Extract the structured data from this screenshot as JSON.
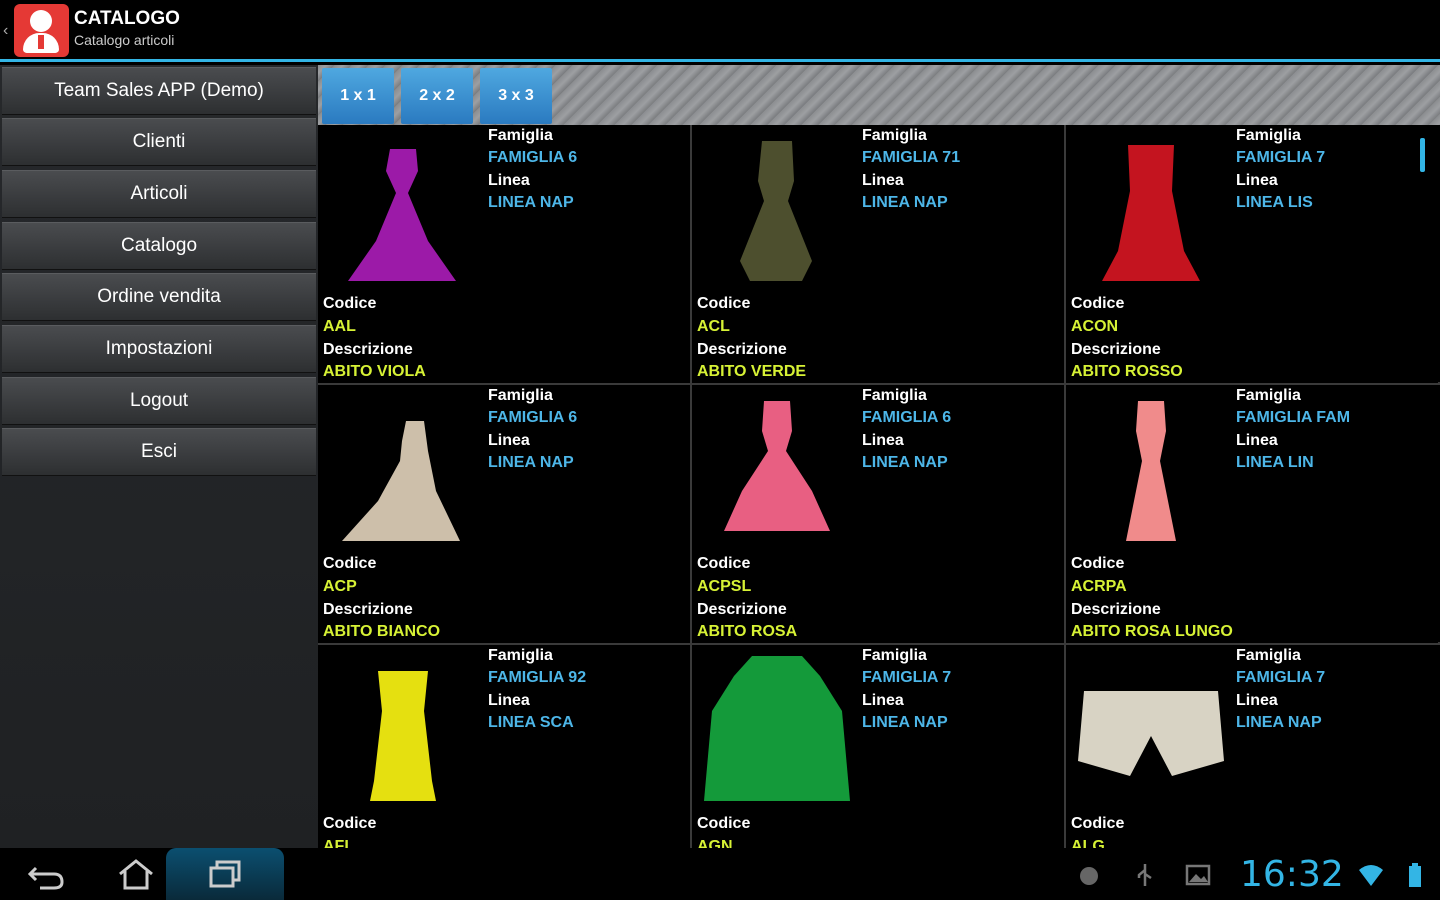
{
  "app": {
    "title": "CATALOGO",
    "subtitle": "Catalogo articoli"
  },
  "sidebar": {
    "items": [
      {
        "label": "Team Sales APP (Demo)"
      },
      {
        "label": "Clienti"
      },
      {
        "label": "Articoli"
      },
      {
        "label": "Catalogo"
      },
      {
        "label": "Ordine vendita"
      },
      {
        "label": "Impostazioni"
      },
      {
        "label": "Logout"
      },
      {
        "label": "Esci"
      }
    ]
  },
  "view_buttons": [
    {
      "label": "1 x 1"
    },
    {
      "label": "2 x 2"
    },
    {
      "label": "3 x 3"
    }
  ],
  "field_labels": {
    "famiglia": "Famiglia",
    "linea": "Linea",
    "codice": "Codice",
    "descrizione": "Descrizione"
  },
  "products": [
    {
      "famiglia": "FAMIGLIA 6",
      "linea": "LINEA NAP",
      "codice": "AAL",
      "descrizione": "ABITO VIOLA",
      "color": "#9c1aa8",
      "image": "purple-gown"
    },
    {
      "famiglia": "FAMIGLIA 71",
      "linea": "LINEA NAP",
      "codice": "ACL",
      "descrizione": "ABITO VERDE",
      "color": "#4d4f2e",
      "image": "olive-dress"
    },
    {
      "famiglia": "FAMIGLIA 7",
      "linea": "LINEA LIS",
      "codice": "ACON",
      "descrizione": "ABITO ROSSO",
      "color": "#c4141f",
      "image": "red-dress"
    },
    {
      "famiglia": "FAMIGLIA 6",
      "linea": "LINEA NAP",
      "codice": "ACP",
      "descrizione": "ABITO BIANCO",
      "color": "#cdbfaa",
      "image": "white-gown"
    },
    {
      "famiglia": "FAMIGLIA 6",
      "linea": "LINEA NAP",
      "codice": "ACPSL",
      "descrizione": "ABITO ROSA",
      "color": "#e85f82",
      "image": "pink-gown"
    },
    {
      "famiglia": "FAMIGLIA FAM",
      "linea": "LINEA LIN",
      "codice": "ACRPA",
      "descrizione": "ABITO ROSA LUNGO",
      "color": "#f08b8b",
      "image": "long-pink-dress"
    },
    {
      "famiglia": "FAMIGLIA 92",
      "linea": "LINEA SCA",
      "codice": "AFL",
      "descrizione": "",
      "color": "#e5e010",
      "image": "yellow-dress"
    },
    {
      "famiglia": "FAMIGLIA 7",
      "linea": "LINEA NAP",
      "codice": "AGN",
      "descrizione": "",
      "color": "#149a3a",
      "image": "green-hoodie"
    },
    {
      "famiglia": "FAMIGLIA 7",
      "linea": "LINEA NAP",
      "codice": "ALG",
      "descrizione": "",
      "color": "#d8d3c4",
      "image": "white-shorts"
    }
  ],
  "status_bar": {
    "time": "16:32"
  }
}
